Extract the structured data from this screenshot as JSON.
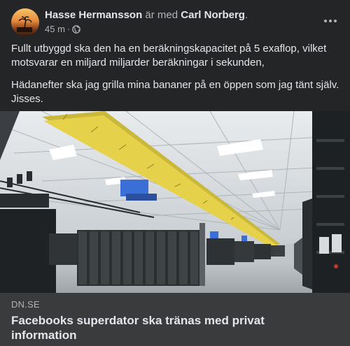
{
  "post": {
    "author": "Hasse Hermansson",
    "with_text": "är med",
    "tagged": "Carl Norberg",
    "period": ".",
    "time": "45 m",
    "dot": "·",
    "paragraph1": "Fullt utbyggd ska den ha en beräkningskapacitet på 5 exaflop, vilket motsvarar en miljard miljarder beräkningar i sekunden,",
    "paragraph2": "Hädanefter ska jag grilla mina bananer på en öppen som jag tänt själv. Jisses."
  },
  "link": {
    "domain": "DN.SE",
    "title": "Facebooks superdator ska tränas med privat information"
  },
  "icons": [
    "globe-icon",
    "more-icon"
  ],
  "colors": {
    "card": "#242526",
    "link_box": "#3a3b3c",
    "text_primary": "#e4e6eb",
    "text_secondary": "#b0b3b8"
  }
}
